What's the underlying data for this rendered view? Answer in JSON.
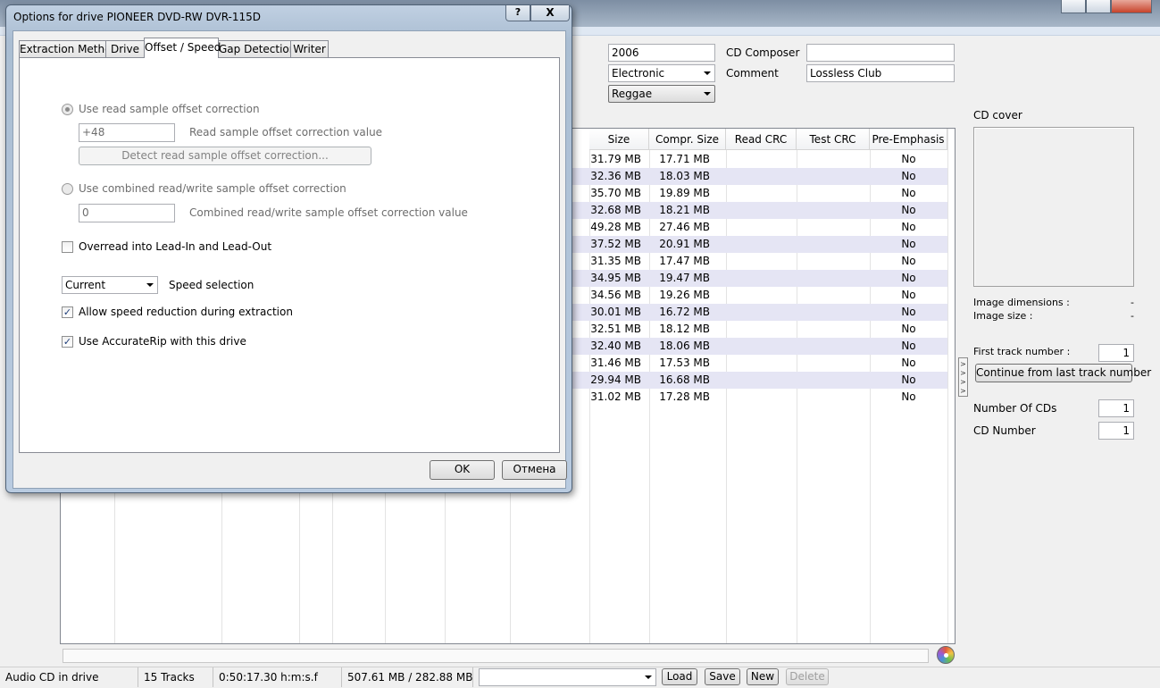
{
  "main": {
    "fields": {
      "year": "2006",
      "genre": "Electronic",
      "genre2": "Reggae",
      "cd_composer_label": "CD Composer",
      "cd_composer_value": "",
      "comment_label": "Comment",
      "comment_value": "Lossless Club"
    },
    "grid": {
      "headers": [
        "Size",
        "Compr. Size",
        "Read CRC",
        "Test CRC",
        "Pre-Emphasis"
      ],
      "rows": [
        {
          "size": "31.79 MB",
          "compr": "17.71 MB",
          "pre": "No"
        },
        {
          "size": "32.36 MB",
          "compr": "18.03 MB",
          "pre": "No"
        },
        {
          "size": "35.70 MB",
          "compr": "19.89 MB",
          "pre": "No"
        },
        {
          "size": "32.68 MB",
          "compr": "18.21 MB",
          "pre": "No"
        },
        {
          "size": "49.28 MB",
          "compr": "27.46 MB",
          "pre": "No"
        },
        {
          "size": "37.52 MB",
          "compr": "20.91 MB",
          "pre": "No"
        },
        {
          "size": "31.35 MB",
          "compr": "17.47 MB",
          "pre": "No"
        },
        {
          "size": "34.95 MB",
          "compr": "19.47 MB",
          "pre": "No"
        },
        {
          "size": "34.56 MB",
          "compr": "19.26 MB",
          "pre": "No"
        },
        {
          "size": "30.01 MB",
          "compr": "16.72 MB",
          "pre": "No"
        },
        {
          "size": "32.51 MB",
          "compr": "18.12 MB",
          "pre": "No"
        },
        {
          "size": "32.40 MB",
          "compr": "18.06 MB",
          "pre": "No"
        },
        {
          "size": "31.46 MB",
          "compr": "17.53 MB",
          "pre": "No"
        },
        {
          "size": "29.94 MB",
          "compr": "16.68 MB",
          "pre": "No"
        },
        {
          "size": "31.02 MB",
          "compr": "17.28 MB",
          "pre": "No"
        }
      ]
    },
    "right_panel": {
      "cd_cover_label": "CD cover",
      "image_dimensions_label": "Image dimensions :",
      "image_dimensions_value": "-",
      "image_size_label": "Image size :",
      "image_size_value": "-",
      "first_track_label": "First track number :",
      "first_track_value": "1",
      "continue_button": "Continue from last track number",
      "number_of_cds_label": "Number Of CDs",
      "number_of_cds_value": "1",
      "cd_number_label": "CD Number",
      "cd_number_value": "1",
      "splitter_glyphs": ">\n>\n>\n>"
    },
    "status_bar": {
      "drive_status": "Audio CD in drive",
      "tracks": "15 Tracks",
      "duration": "0:50:17.30 h:m:s.f",
      "sizes": "507.61 MB / 282.88 MB",
      "profile_value": "",
      "load": "Load",
      "save": "Save",
      "new": "New",
      "delete": "Delete"
    }
  },
  "dialog": {
    "title": "Options for drive PIONEER DVD-RW  DVR-115D",
    "help_glyph": "?",
    "close_glyph": "X",
    "tabs": [
      "Extraction Method",
      "Drive",
      "Offset / Speed",
      "Gap Detection",
      "Writer"
    ],
    "active_tab": "Offset / Speed",
    "read_offset_label": "Use read sample offset correction",
    "read_offset_value": "+48",
    "read_offset_value_label": "Read sample offset correction value",
    "detect_button": "Detect read sample offset correction...",
    "combined_offset_label": "Use combined read/write sample offset correction",
    "combined_offset_value": "0",
    "combined_offset_value_label": "Combined read/write sample offset correction value",
    "overread_label": "Overread into Lead-In and Lead-Out",
    "speed_value": "Current",
    "speed_label": "Speed selection",
    "allow_speed_label": "Allow speed reduction during extraction",
    "accuraterip_label": "Use AccurateRip with this drive",
    "check_glyph": "✓",
    "ok": "OK",
    "cancel": "Отмена"
  }
}
